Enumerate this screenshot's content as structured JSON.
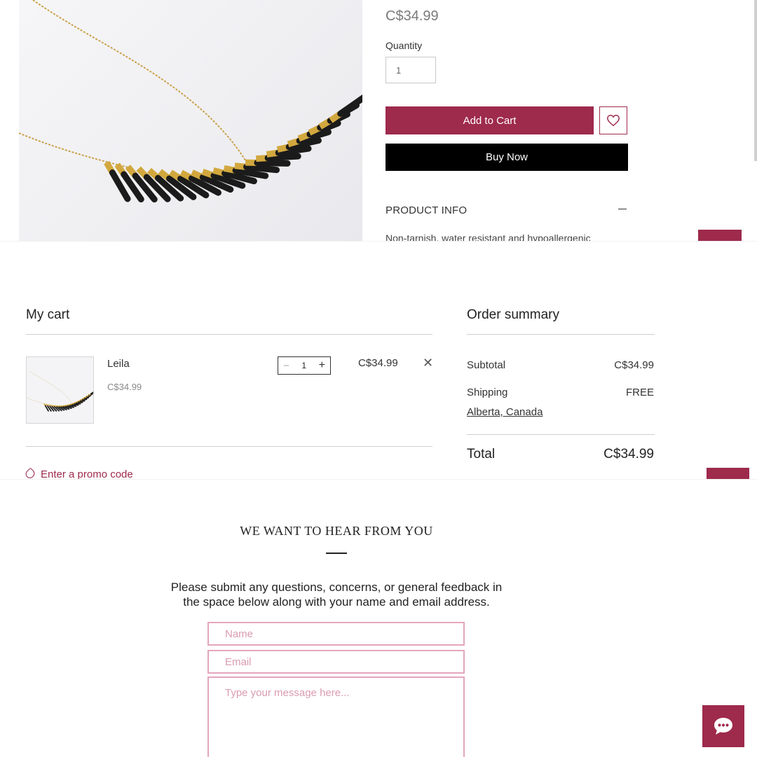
{
  "product": {
    "price": "C$34.99",
    "quantity_label": "Quantity",
    "quantity_value": "1",
    "add_to_cart": "Add to Cart",
    "buy_now": "Buy Now",
    "info_title": "PRODUCT INFO",
    "info_text": "Non-tarnish, water resistant and hypoallergenic",
    "wishlist_icon": "heart-icon"
  },
  "cart": {
    "title": "My cart",
    "items": [
      {
        "name": "Leila",
        "unit_price": "C$34.99",
        "quantity": "1",
        "line_price": "C$34.99",
        "minus": "−",
        "plus": "+",
        "remove": "✕"
      }
    ],
    "promo": "Enter a promo code"
  },
  "summary": {
    "title": "Order summary",
    "subtotal_label": "Subtotal",
    "subtotal_value": "C$34.99",
    "shipping_label": "Shipping",
    "shipping_value": "FREE",
    "shipping_location": "Alberta, Canada",
    "total_label": "Total",
    "total_value": "C$34.99"
  },
  "contact": {
    "heading": "WE WANT TO HEAR FROM YOU",
    "description_line1": "Please submit any questions, concerns, or general feedback in",
    "description_line2": "the space below along with your name and email address.",
    "name_placeholder": "Name",
    "email_placeholder": "Email",
    "message_placeholder": "Type your message here...",
    "chat_icon": "chat-bubble-icon"
  },
  "colors": {
    "accent": "#9e2a4c",
    "field_border": "#e4a6bd",
    "primary_dark": "#000000"
  }
}
